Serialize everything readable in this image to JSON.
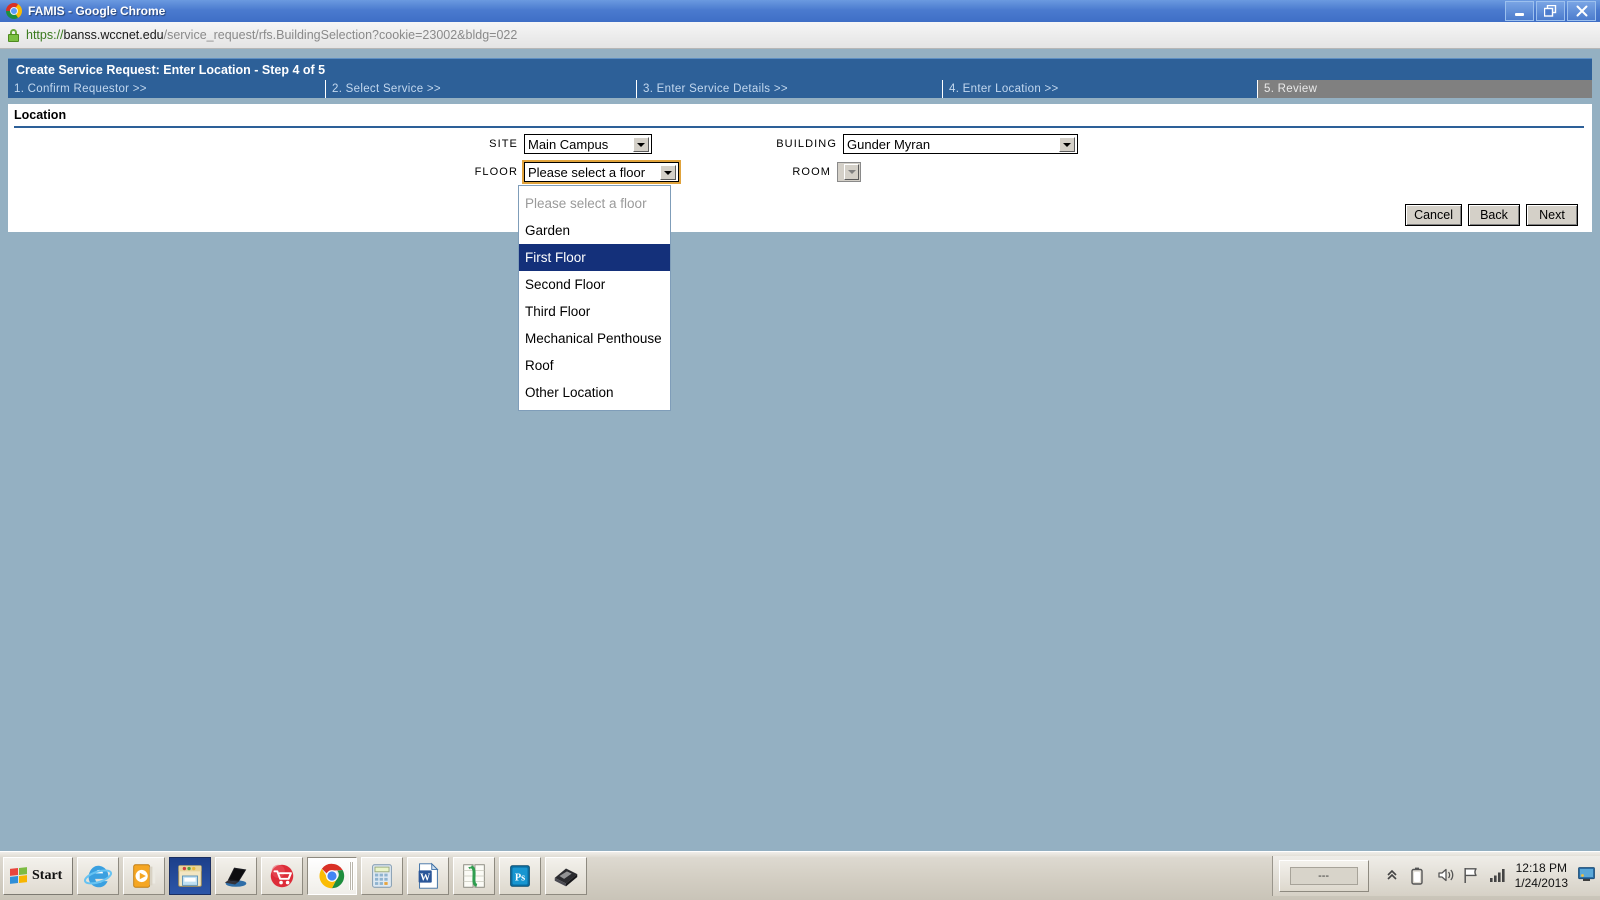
{
  "browser": {
    "window_title": "FAMIS - Google Chrome",
    "logo_icon": "chrome-logo-icon",
    "window_controls": {
      "minimize": "minimize-icon",
      "restore": "restore-icon",
      "close": "close-icon"
    },
    "url": {
      "lock_icon": "ssl-lock-icon",
      "scheme": "https://",
      "host": "banss.wccnet.edu",
      "path": "/service_request/rfs.BuildingSelection?cookie=23002&bldg=022",
      "full": "https://banss.wccnet.edu/service_request/rfs.BuildingSelection?cookie=23002&bldg=022"
    }
  },
  "app": {
    "header_title": "Create Service Request: Enter Location - Step 4 of 5",
    "steps": [
      {
        "label": "1. Confirm Requestor >>",
        "current": false
      },
      {
        "label": "2. Select Service >>",
        "current": false
      },
      {
        "label": "3. Enter Service Details >>",
        "current": false
      },
      {
        "label": "4. Enter Location >>",
        "current": false
      },
      {
        "label": "5. Review",
        "current": true
      }
    ],
    "section_title": "Location",
    "fields": {
      "site": {
        "label": "SITE",
        "value": "Main Campus"
      },
      "building": {
        "label": "BUILDING",
        "value": "Gunder Myran"
      },
      "floor": {
        "label": "FLOOR",
        "value": "Please select a floor",
        "open": true,
        "focused": true,
        "options": [
          {
            "label": "Please select a floor",
            "placeholder": true,
            "selected": false
          },
          {
            "label": "Garden",
            "placeholder": false,
            "selected": false
          },
          {
            "label": "First Floor",
            "placeholder": false,
            "selected": true
          },
          {
            "label": "Second Floor",
            "placeholder": false,
            "selected": false
          },
          {
            "label": "Third Floor",
            "placeholder": false,
            "selected": false
          },
          {
            "label": "Mechanical Penthouse",
            "placeholder": false,
            "selected": false
          },
          {
            "label": "Roof",
            "placeholder": false,
            "selected": false
          },
          {
            "label": "Other Location",
            "placeholder": false,
            "selected": false
          }
        ]
      },
      "room": {
        "label": "ROOM",
        "value": "",
        "disabled": true
      }
    },
    "buttons": {
      "cancel": "Cancel",
      "back": "Back",
      "next": "Next"
    },
    "colors": {
      "header_blue": "#2d6098",
      "current_step_gray": "#808080",
      "selected_option": "#14307a",
      "focus_outline": "#e0a33c",
      "desktop": "#94b0c2"
    }
  },
  "taskbar": {
    "start_label": "Start",
    "start_icon": "windows-flag-icon",
    "items": [
      {
        "name": "internet-explorer-icon"
      },
      {
        "name": "media-player-icon"
      },
      {
        "name": "file-explorer-icon"
      },
      {
        "name": "laptop-icon"
      },
      {
        "name": "shopping-cart-icon"
      },
      {
        "name": "google-chrome-icon"
      },
      {
        "name": "calculator-icon"
      },
      {
        "name": "microsoft-word-icon"
      },
      {
        "name": "spreadsheet-icon"
      },
      {
        "name": "photoshop-icon"
      },
      {
        "name": "books-icon"
      }
    ],
    "language_bar_label": "---",
    "tray": {
      "show_hidden_icon": "chevron-up-icon",
      "battery_icon": "battery-icon",
      "volume_icon": "volume-icon",
      "flag_icon": "action-center-flag-icon",
      "network_icon": "signal-bars-icon",
      "show_desktop_icon": "show-desktop-icon",
      "time": "12:18 PM",
      "date": "1/24/2013"
    }
  }
}
